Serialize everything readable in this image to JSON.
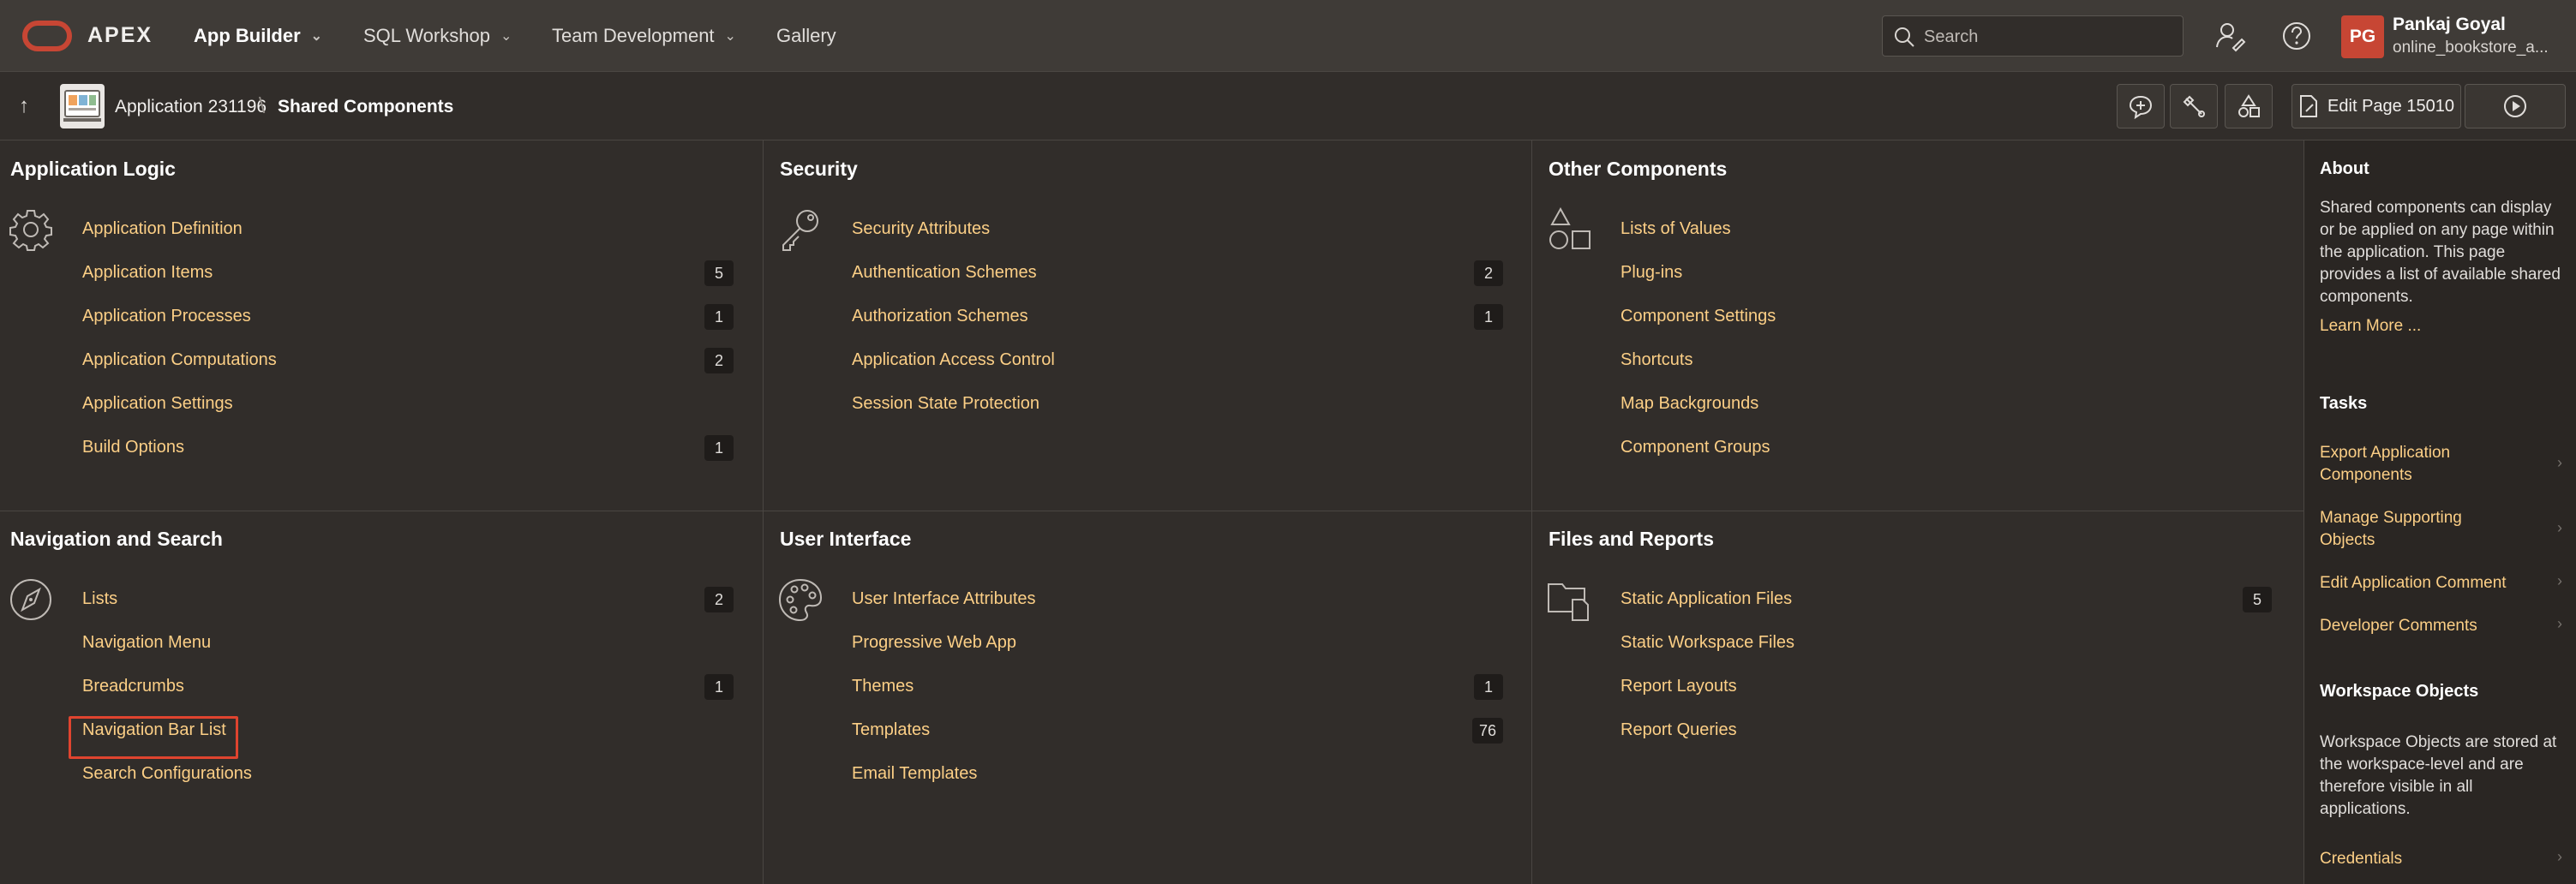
{
  "header": {
    "brand": "APEX",
    "nav": [
      {
        "label": "App Builder"
      },
      {
        "label": "SQL Workshop"
      },
      {
        "label": "Team Development"
      },
      {
        "label": "Gallery"
      }
    ],
    "search_placeholder": "Search",
    "user": {
      "initials": "PG",
      "name": "Pankaj Goyal",
      "workspace": "online_bookstore_a..."
    }
  },
  "breadcrumb": {
    "application": "Application 231196",
    "separator": "\\",
    "current": "Shared Components",
    "edit_page_label": "Edit Page 15010"
  },
  "regions": [
    {
      "title": "Application Logic",
      "icon": "gear-icon",
      "items": [
        {
          "label": "Application Definition",
          "count": ""
        },
        {
          "label": "Application Items",
          "count": "5"
        },
        {
          "label": "Application Processes",
          "count": "1"
        },
        {
          "label": "Application Computations",
          "count": "2"
        },
        {
          "label": "Application Settings",
          "count": ""
        },
        {
          "label": "Build Options",
          "count": "1"
        }
      ]
    },
    {
      "title": "Security",
      "icon": "key-icon",
      "items": [
        {
          "label": "Security Attributes",
          "count": ""
        },
        {
          "label": "Authentication Schemes",
          "count": "2"
        },
        {
          "label": "Authorization Schemes",
          "count": "1"
        },
        {
          "label": "Application Access Control",
          "count": ""
        },
        {
          "label": "Session State Protection",
          "count": ""
        }
      ]
    },
    {
      "title": "Other Components",
      "icon": "shapes-icon",
      "items": [
        {
          "label": "Lists of Values",
          "count": ""
        },
        {
          "label": "Plug-ins",
          "count": ""
        },
        {
          "label": "Component Settings",
          "count": ""
        },
        {
          "label": "Shortcuts",
          "count": ""
        },
        {
          "label": "Map Backgrounds",
          "count": ""
        },
        {
          "label": "Component Groups",
          "count": ""
        }
      ]
    },
    {
      "title": "Navigation and Search",
      "icon": "compass-icon",
      "items": [
        {
          "label": "Lists",
          "count": "2"
        },
        {
          "label": "Navigation Menu",
          "count": ""
        },
        {
          "label": "Breadcrumbs",
          "count": "1"
        },
        {
          "label": "Navigation Bar List",
          "count": ""
        },
        {
          "label": "Search Configurations",
          "count": ""
        }
      ]
    },
    {
      "title": "User Interface",
      "icon": "palette-icon",
      "items": [
        {
          "label": "User Interface Attributes",
          "count": ""
        },
        {
          "label": "Progressive Web App",
          "count": ""
        },
        {
          "label": "Themes",
          "count": "1"
        },
        {
          "label": "Templates",
          "count": "76"
        },
        {
          "label": "Email Templates",
          "count": ""
        }
      ]
    },
    {
      "title": "Files and Reports",
      "icon": "files-icon",
      "items": [
        {
          "label": "Static Application Files",
          "count": "5"
        },
        {
          "label": "Static Workspace Files",
          "count": ""
        },
        {
          "label": "Report Layouts",
          "count": ""
        },
        {
          "label": "Report Queries",
          "count": ""
        }
      ]
    }
  ],
  "sidebar": {
    "about_title": "About",
    "about_text": "Shared components can display or be applied on any page within the application. This page provides a list of available shared components.",
    "learn_more": "Learn More ...",
    "tasks_title": "Tasks",
    "tasks": [
      {
        "label": "Export Application Components"
      },
      {
        "label": "Manage Supporting Objects"
      },
      {
        "label": "Edit Application Comment"
      },
      {
        "label": "Developer Comments"
      }
    ],
    "workspace_title": "Workspace Objects",
    "workspace_text": "Workspace Objects are stored at the workspace-level and are therefore visible in all applications.",
    "workspace_link": "Credentials"
  },
  "colors": {
    "accent_link": "#fccf86",
    "highlight_border": "#e0442f",
    "avatar": "#c74634"
  }
}
